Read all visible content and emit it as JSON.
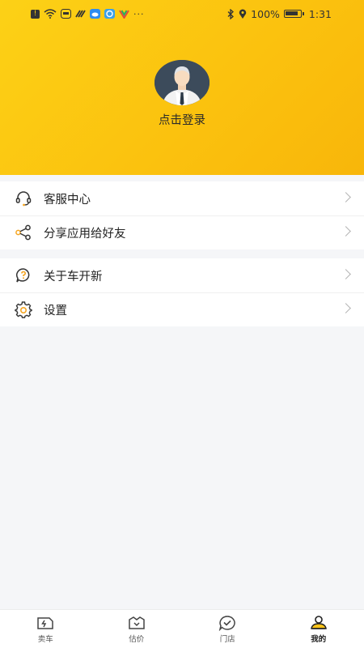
{
  "status_bar": {
    "battery_percent": "100%",
    "time": "1:31",
    "more_indicator": "···"
  },
  "profile": {
    "login_prompt": "点击登录"
  },
  "menu_group_1": [
    {
      "label": "客服中心",
      "icon": "headset-icon"
    },
    {
      "label": "分享应用给好友",
      "icon": "share-icon"
    }
  ],
  "menu_group_2": [
    {
      "label": "关于车开新",
      "icon": "question-icon"
    },
    {
      "label": "设置",
      "icon": "gear-icon"
    }
  ],
  "tabbar": {
    "tabs": [
      {
        "label": "卖车",
        "icon": "sell-car-icon",
        "active": false
      },
      {
        "label": "估价",
        "icon": "valuation-icon",
        "active": false
      },
      {
        "label": "门店",
        "icon": "store-icon",
        "active": false
      },
      {
        "label": "我的",
        "icon": "profile-icon",
        "active": true
      }
    ]
  },
  "colors": {
    "header_accent": "#fcd116",
    "icon_accent": "#f5a623"
  }
}
